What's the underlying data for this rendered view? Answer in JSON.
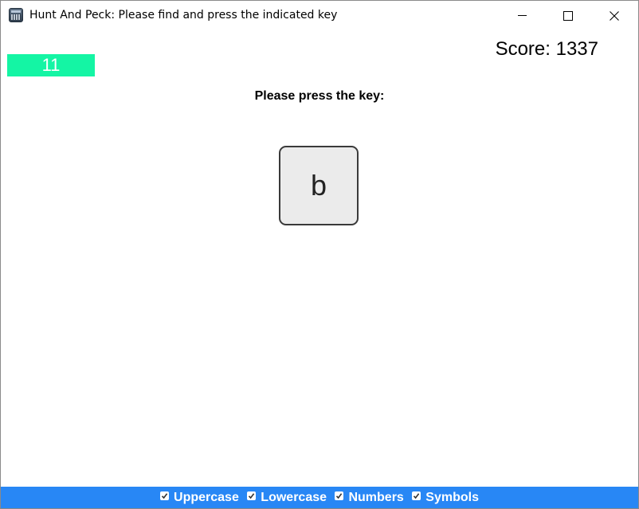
{
  "window": {
    "title": "Hunt And Peck: Please find and press the indicated key",
    "icon": "keyboard-app-icon",
    "controls": [
      "minimize-icon",
      "maximize-icon",
      "close-icon"
    ]
  },
  "timer": {
    "value": "11",
    "color": "#14f5a4"
  },
  "score": {
    "label": "Score: 1337"
  },
  "prompt": {
    "text": "Please press the key:"
  },
  "key": {
    "char": "b"
  },
  "options": {
    "bar_color": "#2887f5",
    "items": [
      {
        "label": "Uppercase",
        "checked": true
      },
      {
        "label": "Lowercase",
        "checked": true
      },
      {
        "label": "Numbers",
        "checked": true
      },
      {
        "label": "Symbols",
        "checked": true
      }
    ]
  }
}
